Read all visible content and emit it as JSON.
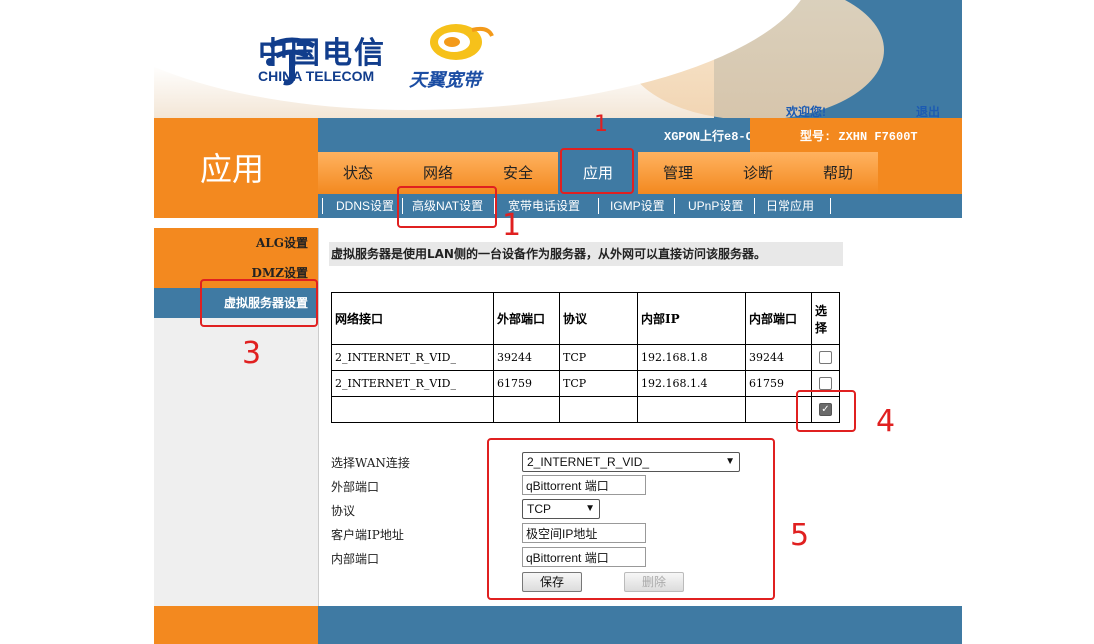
{
  "brand": {
    "telecom_cn": "中国电信",
    "telecom_en": "CHINA TELECOM",
    "tianyi": "天翼宽带"
  },
  "header": {
    "welcome": "欢迎您!",
    "logout": "退出",
    "device": "XGPON上行e8-C",
    "model": "型号: ZXHN F7600T"
  },
  "section_title": "应用",
  "nav": {
    "tabs": [
      {
        "label": "状态"
      },
      {
        "label": "网络"
      },
      {
        "label": "安全"
      },
      {
        "label": "应用",
        "active": true
      },
      {
        "label": "管理"
      },
      {
        "label": "诊断"
      },
      {
        "label": "帮助"
      }
    ]
  },
  "subnav": {
    "items": [
      {
        "label": "DDNS设置"
      },
      {
        "label": "高级NAT设置"
      },
      {
        "label": "宽带电话设置"
      },
      {
        "label": "IGMP设置"
      },
      {
        "label": "UPnP设置"
      },
      {
        "label": "日常应用"
      }
    ]
  },
  "sidebar": {
    "items": [
      {
        "label": "ALG设置"
      },
      {
        "label": "DMZ设置"
      },
      {
        "label": "虚拟服务器设置",
        "active": true
      }
    ]
  },
  "description": "虚拟服务器是使用LAN侧的一台设备作为服务器，从外网可以直接访问该服务器。",
  "table": {
    "headers": [
      "网络接口",
      "外部端口",
      "协议",
      "内部IP",
      "内部端口",
      "选择"
    ],
    "rows": [
      {
        "iface": "2_INTERNET_R_VID_",
        "ext_port": "39244",
        "proto": "TCP",
        "ip": "192.168.1.8",
        "int_port": "39244",
        "checked": false
      },
      {
        "iface": "2_INTERNET_R_VID_",
        "ext_port": "61759",
        "proto": "TCP",
        "ip": "192.168.1.4",
        "int_port": "61759",
        "checked": false
      },
      {
        "iface": "",
        "ext_port": "",
        "proto": "",
        "ip": "",
        "int_port": "",
        "checked": true
      }
    ]
  },
  "form": {
    "wan_label": "选择WAN连接",
    "wan_value": "2_INTERNET_R_VID_",
    "ext_port_label": "外部端口",
    "ext_port_value": "qBittorrent 端口",
    "proto_label": "协议",
    "proto_value": "TCP",
    "client_ip_label": "客户端IP地址",
    "client_ip_value": "极空间IP地址",
    "int_port_label": "内部端口",
    "int_port_value": "qBittorrent 端口",
    "save_label": "保存",
    "delete_label": "删除"
  },
  "annotations": {
    "color": "#e02020",
    "numbers": [
      "1",
      "1",
      "3",
      "4",
      "5"
    ]
  },
  "colors": {
    "orange": "#f3891f",
    "blue": "#3f7aa3"
  }
}
